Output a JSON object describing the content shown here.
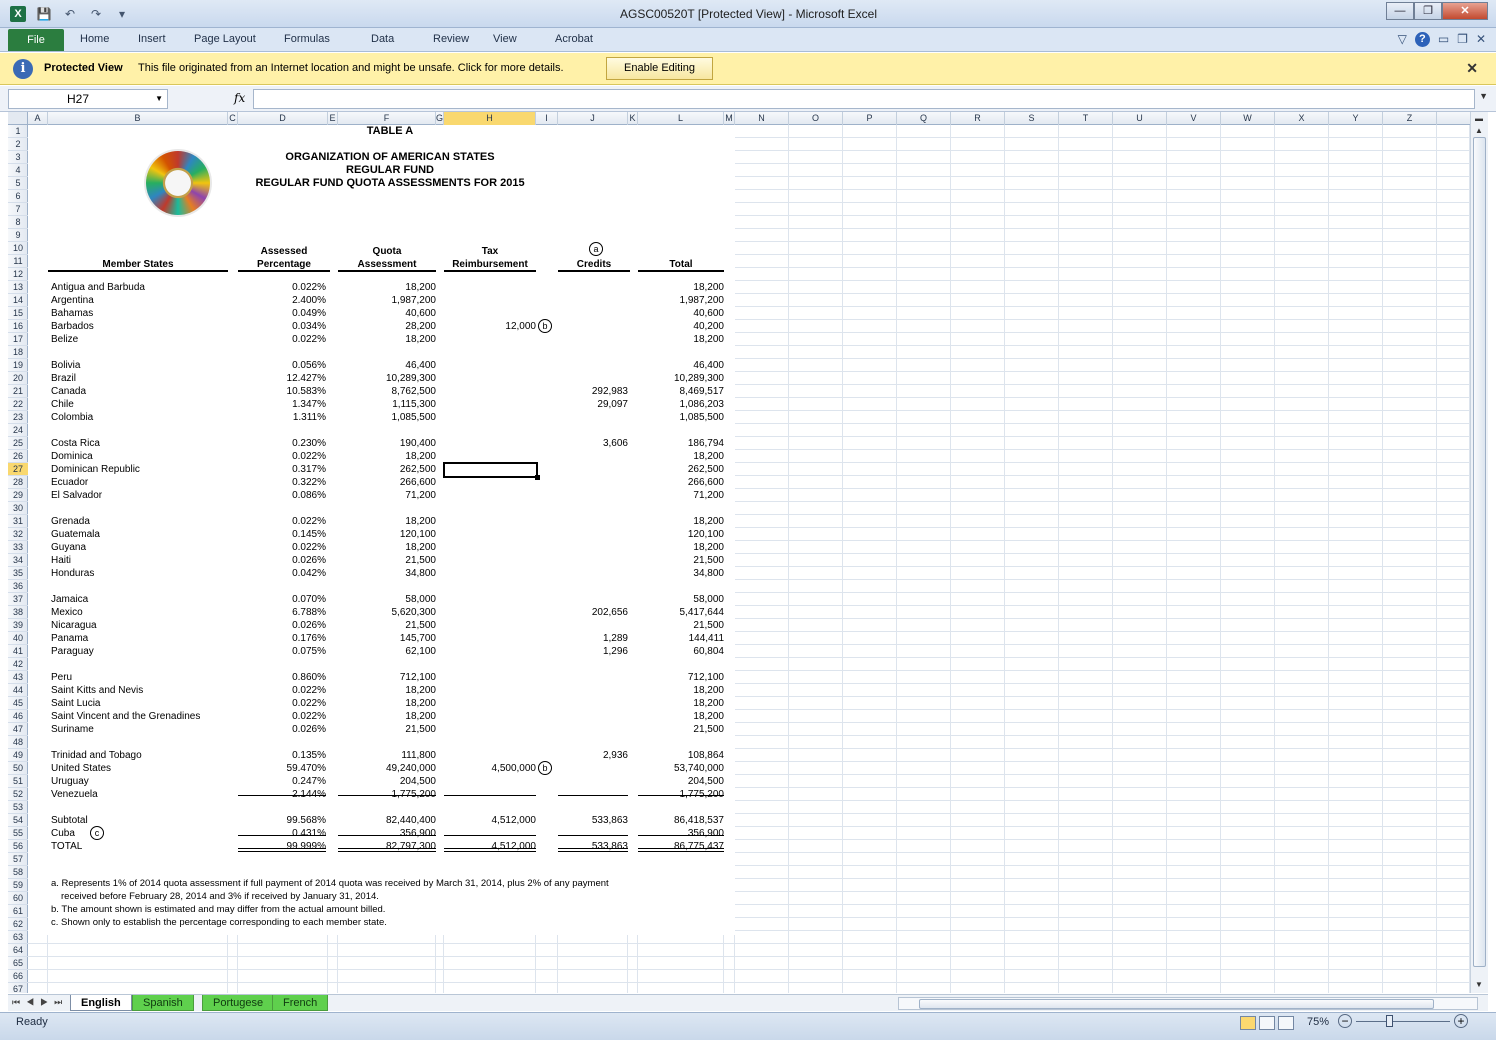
{
  "window": {
    "title": "AGSC00520T  [Protected View]  -  Microsoft Excel",
    "app_icon": "X",
    "qat_icons": [
      "save-icon",
      "undo-icon",
      "redo-icon",
      "customize-icon"
    ],
    "controls": [
      "minimize-icon",
      "restore-icon",
      "close-icon"
    ]
  },
  "ribbon": {
    "file": "File",
    "tabs": [
      "Home",
      "Insert",
      "Page Layout",
      "Formulas",
      "Data",
      "Review",
      "View",
      "Acrobat"
    ],
    "help": "?"
  },
  "protected_view": {
    "title": "Protected View",
    "message": "This file originated from an Internet location and might be unsafe. Click for more details.",
    "button": "Enable Editing",
    "close": "✕"
  },
  "formula_bar": {
    "name_box": "H27",
    "fx": "fx",
    "formula": ""
  },
  "columns": [
    "A",
    "B",
    "C",
    "D",
    "E",
    "F",
    "G",
    "H",
    "I",
    "J",
    "K",
    "L",
    "M",
    "N",
    "O",
    "P",
    "Q",
    "R",
    "S",
    "T",
    "U",
    "V",
    "W",
    "X",
    "Y",
    "Z"
  ],
  "selected_column": "H",
  "selected_row": "27",
  "rows": [
    "1",
    "2",
    "3",
    "4",
    "5",
    "6",
    "7",
    "8",
    "9",
    "10",
    "11",
    "12",
    "13",
    "14",
    "15",
    "16",
    "17",
    "18",
    "19",
    "20",
    "21",
    "22",
    "23",
    "24",
    "25",
    "26",
    "27",
    "28",
    "29",
    "30",
    "31",
    "32",
    "33",
    "34",
    "35",
    "36",
    "37",
    "38",
    "39",
    "40",
    "41",
    "42",
    "43",
    "44",
    "45",
    "46",
    "47",
    "48",
    "49",
    "50",
    "51",
    "52",
    "53",
    "54",
    "55",
    "56",
    "57",
    "58",
    "59",
    "60",
    "61",
    "62",
    "63",
    "64",
    "65",
    "66",
    "67"
  ],
  "sheet": {
    "table_label": "TABLE A",
    "title_1": "ORGANIZATION OF AMERICAN STATES",
    "title_2": "REGULAR FUND",
    "title_3": "REGULAR FUND QUOTA ASSESSMENTS FOR 2015",
    "headers": {
      "member_states": "Member States",
      "assessed_1": "Assessed",
      "assessed_2": "Percentage",
      "quota_1": "Quota",
      "quota_2": "Assessment",
      "tax_1": "Tax",
      "tax_2": "Reimbursement",
      "credits_note": "a",
      "credits": "Credits",
      "total": "Total"
    },
    "members": [
      {
        "row": 13,
        "name": "Antigua and Barbuda",
        "pct": "0.022%",
        "quota": "18,200",
        "tax": "",
        "tax_note": "",
        "credits": "",
        "total": "18,200"
      },
      {
        "row": 14,
        "name": "Argentina",
        "pct": "2.400%",
        "quota": "1,987,200",
        "tax": "",
        "tax_note": "",
        "credits": "",
        "total": "1,987,200"
      },
      {
        "row": 15,
        "name": "Bahamas",
        "pct": "0.049%",
        "quota": "40,600",
        "tax": "",
        "tax_note": "",
        "credits": "",
        "total": "40,600"
      },
      {
        "row": 16,
        "name": "Barbados",
        "pct": "0.034%",
        "quota": "28,200",
        "tax": "12,000",
        "tax_note": "b",
        "credits": "",
        "total": "40,200"
      },
      {
        "row": 17,
        "name": "Belize",
        "pct": "0.022%",
        "quota": "18,200",
        "tax": "",
        "tax_note": "",
        "credits": "",
        "total": "18,200"
      },
      {
        "row": 19,
        "name": "Bolivia",
        "pct": "0.056%",
        "quota": "46,400",
        "tax": "",
        "tax_note": "",
        "credits": "",
        "total": "46,400"
      },
      {
        "row": 20,
        "name": "Brazil",
        "pct": "12.427%",
        "quota": "10,289,300",
        "tax": "",
        "tax_note": "",
        "credits": "",
        "total": "10,289,300"
      },
      {
        "row": 21,
        "name": "Canada",
        "pct": "10.583%",
        "quota": "8,762,500",
        "tax": "",
        "tax_note": "",
        "credits": "292,983",
        "total": "8,469,517"
      },
      {
        "row": 22,
        "name": "Chile",
        "pct": "1.347%",
        "quota": "1,115,300",
        "tax": "",
        "tax_note": "",
        "credits": "29,097",
        "total": "1,086,203"
      },
      {
        "row": 23,
        "name": "Colombia",
        "pct": "1.311%",
        "quota": "1,085,500",
        "tax": "",
        "tax_note": "",
        "credits": "",
        "total": "1,085,500"
      },
      {
        "row": 25,
        "name": "Costa Rica",
        "pct": "0.230%",
        "quota": "190,400",
        "tax": "",
        "tax_note": "",
        "credits": "3,606",
        "total": "186,794"
      },
      {
        "row": 26,
        "name": "Dominica",
        "pct": "0.022%",
        "quota": "18,200",
        "tax": "",
        "tax_note": "",
        "credits": "",
        "total": "18,200"
      },
      {
        "row": 27,
        "name": "Dominican Republic",
        "pct": "0.317%",
        "quota": "262,500",
        "tax": "",
        "tax_note": "",
        "credits": "",
        "total": "262,500"
      },
      {
        "row": 28,
        "name": "Ecuador",
        "pct": "0.322%",
        "quota": "266,600",
        "tax": "",
        "tax_note": "",
        "credits": "",
        "total": "266,600"
      },
      {
        "row": 29,
        "name": "El Salvador",
        "pct": "0.086%",
        "quota": "71,200",
        "tax": "",
        "tax_note": "",
        "credits": "",
        "total": "71,200"
      },
      {
        "row": 31,
        "name": "Grenada",
        "pct": "0.022%",
        "quota": "18,200",
        "tax": "",
        "tax_note": "",
        "credits": "",
        "total": "18,200"
      },
      {
        "row": 32,
        "name": "Guatemala",
        "pct": "0.145%",
        "quota": "120,100",
        "tax": "",
        "tax_note": "",
        "credits": "",
        "total": "120,100"
      },
      {
        "row": 33,
        "name": "Guyana",
        "pct": "0.022%",
        "quota": "18,200",
        "tax": "",
        "tax_note": "",
        "credits": "",
        "total": "18,200"
      },
      {
        "row": 34,
        "name": "Haiti",
        "pct": "0.026%",
        "quota": "21,500",
        "tax": "",
        "tax_note": "",
        "credits": "",
        "total": "21,500"
      },
      {
        "row": 35,
        "name": "Honduras",
        "pct": "0.042%",
        "quota": "34,800",
        "tax": "",
        "tax_note": "",
        "credits": "",
        "total": "34,800"
      },
      {
        "row": 37,
        "name": "Jamaica",
        "pct": "0.070%",
        "quota": "58,000",
        "tax": "",
        "tax_note": "",
        "credits": "",
        "total": "58,000"
      },
      {
        "row": 38,
        "name": "Mexico",
        "pct": "6.788%",
        "quota": "5,620,300",
        "tax": "",
        "tax_note": "",
        "credits": "202,656",
        "total": "5,417,644"
      },
      {
        "row": 39,
        "name": "Nicaragua",
        "pct": "0.026%",
        "quota": "21,500",
        "tax": "",
        "tax_note": "",
        "credits": "",
        "total": "21,500"
      },
      {
        "row": 40,
        "name": "Panama",
        "pct": "0.176%",
        "quota": "145,700",
        "tax": "",
        "tax_note": "",
        "credits": "1,289",
        "total": "144,411"
      },
      {
        "row": 41,
        "name": "Paraguay",
        "pct": "0.075%",
        "quota": "62,100",
        "tax": "",
        "tax_note": "",
        "credits": "1,296",
        "total": "60,804"
      },
      {
        "row": 43,
        "name": "Peru",
        "pct": "0.860%",
        "quota": "712,100",
        "tax": "",
        "tax_note": "",
        "credits": "",
        "total": "712,100"
      },
      {
        "row": 44,
        "name": "Saint Kitts and Nevis",
        "pct": "0.022%",
        "quota": "18,200",
        "tax": "",
        "tax_note": "",
        "credits": "",
        "total": "18,200"
      },
      {
        "row": 45,
        "name": "Saint Lucia",
        "pct": "0.022%",
        "quota": "18,200",
        "tax": "",
        "tax_note": "",
        "credits": "",
        "total": "18,200"
      },
      {
        "row": 46,
        "name": "Saint Vincent and the Grenadines",
        "pct": "0.022%",
        "quota": "18,200",
        "tax": "",
        "tax_note": "",
        "credits": "",
        "total": "18,200"
      },
      {
        "row": 47,
        "name": "Suriname",
        "pct": "0.026%",
        "quota": "21,500",
        "tax": "",
        "tax_note": "",
        "credits": "",
        "total": "21,500"
      },
      {
        "row": 49,
        "name": "Trinidad and Tobago",
        "pct": "0.135%",
        "quota": "111,800",
        "tax": "",
        "tax_note": "",
        "credits": "2,936",
        "total": "108,864"
      },
      {
        "row": 50,
        "name": "United States",
        "pct": "59.470%",
        "quota": "49,240,000",
        "tax": "4,500,000",
        "tax_note": "b",
        "credits": "",
        "total": "53,740,000"
      },
      {
        "row": 51,
        "name": "Uruguay",
        "pct": "0.247%",
        "quota": "204,500",
        "tax": "",
        "tax_note": "",
        "credits": "",
        "total": "204,500"
      },
      {
        "row": 52,
        "name": "Venezuela",
        "pct": "2.144%",
        "quota": "1,775,200",
        "tax": "",
        "tax_note": "",
        "credits": "",
        "total": "1,775,200"
      }
    ],
    "summary": [
      {
        "row": 54,
        "name": "Subtotal",
        "note": "",
        "pct": "99.568%",
        "quota": "82,440,400",
        "tax": "4,512,000",
        "credits": "533,863",
        "total": "86,418,537"
      },
      {
        "row": 55,
        "name": "Cuba",
        "note": "c",
        "pct": "0.431%",
        "quota": "356,900",
        "tax": "",
        "credits": "",
        "total": "356,900"
      },
      {
        "row": 56,
        "name": "TOTAL",
        "note": "",
        "pct": "99.999%",
        "quota": "82,797,300",
        "tax": "4,512,000",
        "credits": "533,863",
        "total": "86,775,437"
      }
    ],
    "notes": [
      "a. Represents 1% of 2014 quota assessment if full payment of 2014 quota was received by March 31, 2014,  plus 2% of any payment",
      "received before February 28, 2014 and 3% if received by January 31, 2014.",
      "b. The amount shown is estimated and may differ from the actual amount billed.",
      "c. Shown only to establish the percentage corresponding to each member state."
    ]
  },
  "sheet_tabs": [
    "English",
    "Spanish",
    "Portugese",
    "French"
  ],
  "active_tab": "English",
  "status": {
    "ready": "Ready",
    "zoom": "75%",
    "zoom_minus": "−",
    "zoom_plus": "+"
  }
}
